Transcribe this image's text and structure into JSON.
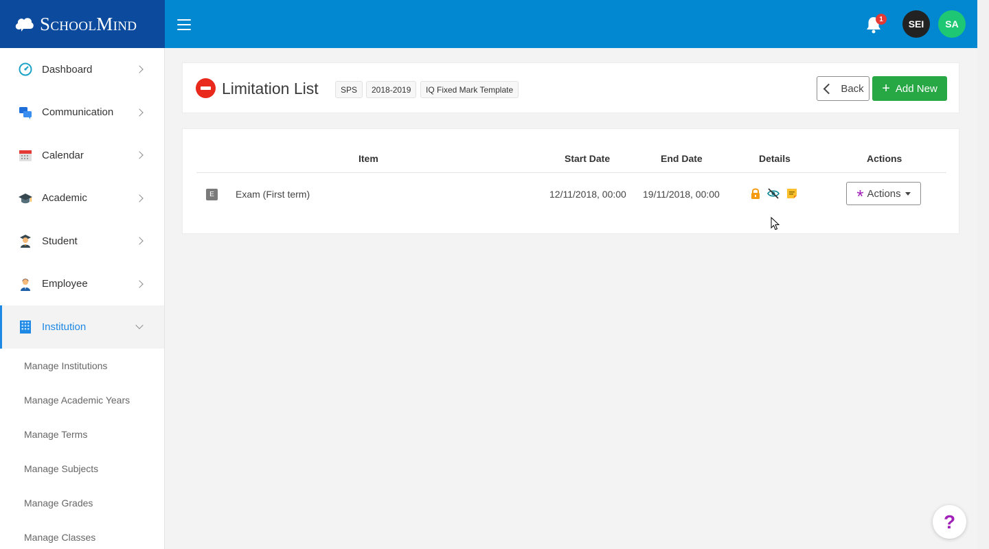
{
  "brand": {
    "name": "SchoolMind"
  },
  "header": {
    "notification_count": "1",
    "user_initials_1": "SEI",
    "user_initials_2": "SA"
  },
  "sidebar": {
    "items": [
      {
        "label": "Dashboard",
        "icon": "dashboard-gauge-icon"
      },
      {
        "label": "Communication",
        "icon": "chat-bubbles-icon"
      },
      {
        "label": "Calendar",
        "icon": "calendar-icon"
      },
      {
        "label": "Academic",
        "icon": "graduation-cap-icon"
      },
      {
        "label": "Student",
        "icon": "student-icon"
      },
      {
        "label": "Employee",
        "icon": "employee-icon"
      },
      {
        "label": "Institution",
        "icon": "building-icon",
        "active": true
      }
    ],
    "sub_items": [
      "Manage Institutions",
      "Manage Academic Years",
      "Manage Terms",
      "Manage Subjects",
      "Manage Grades",
      "Manage Classes"
    ]
  },
  "page": {
    "title": "Limitation List",
    "tags": [
      "SPS",
      "2018-2019",
      "IQ Fixed Mark Template"
    ],
    "back_label": "Back",
    "add_label": "Add New"
  },
  "table": {
    "columns": [
      "Item",
      "Start Date",
      "End Date",
      "Details",
      "Actions"
    ],
    "rows": [
      {
        "type_badge": "E",
        "item": "Exam (First term)",
        "start_date": "12/11/2018, 00:00",
        "end_date": "19/11/2018, 00:00",
        "details_icons": [
          "lock-icon",
          "eye-off-icon",
          "note-icon"
        ],
        "actions_label": "Actions"
      }
    ]
  },
  "help": {
    "label": "?"
  },
  "colors": {
    "topbar": "#0288d1",
    "brand_bg": "#0b4a9c",
    "accent": "#1e88e5",
    "add_button": "#28a745",
    "danger": "#e8291c",
    "actions_asterisk": "#a020b8"
  }
}
